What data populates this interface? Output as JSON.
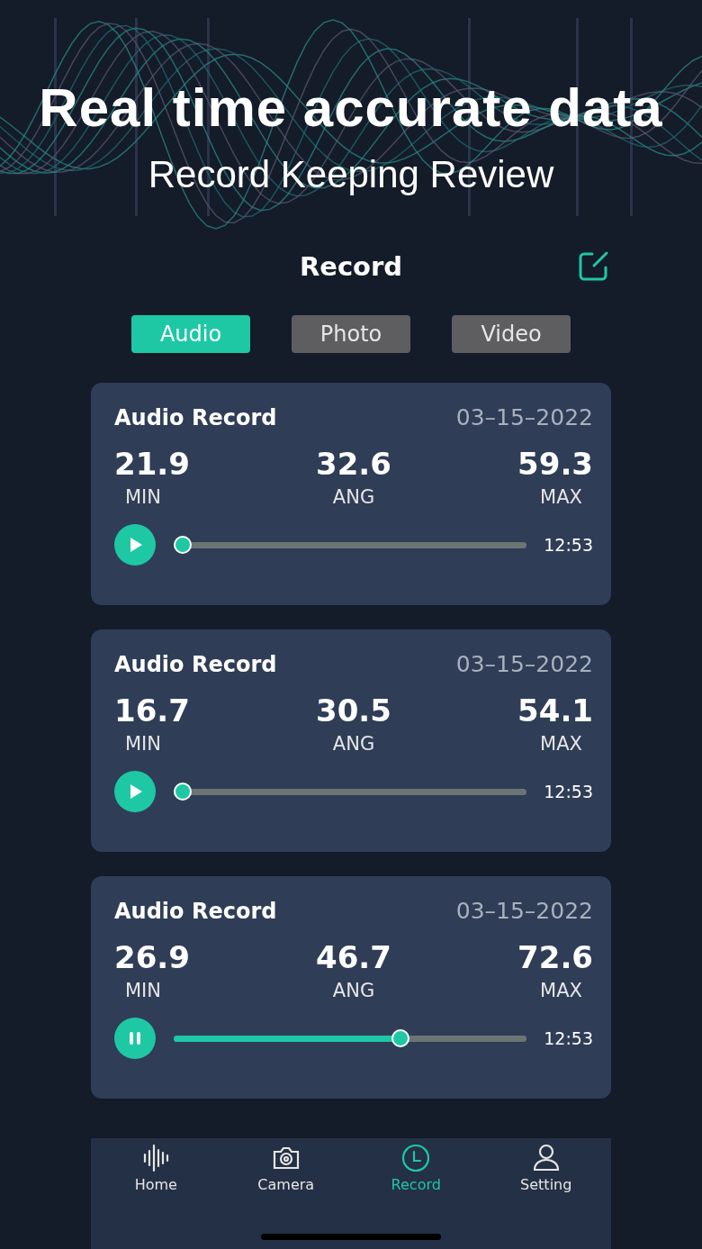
{
  "headline": "Real time accurate data",
  "subtitle": "Record Keeping Review",
  "screen": {
    "title": "Record",
    "tabs": [
      {
        "label": "Audio",
        "selected": true
      },
      {
        "label": "Photo",
        "selected": false
      },
      {
        "label": "Video",
        "selected": false
      }
    ],
    "records": [
      {
        "title": "Audio Record",
        "date": "03–15–2022",
        "stats": [
          {
            "value": "21.9",
            "label": "MIN"
          },
          {
            "value": "32.6",
            "label": "ANG"
          },
          {
            "value": "59.3",
            "label": "MAX"
          }
        ],
        "playing": false,
        "level": 0,
        "duration": "12:53"
      },
      {
        "title": "Audio Record",
        "date": "03–15–2022",
        "stats": [
          {
            "value": "16.7",
            "label": "MIN"
          },
          {
            "value": "30.5",
            "label": "ANG"
          },
          {
            "value": "54.1",
            "label": "MAX"
          }
        ],
        "playing": false,
        "level": 0,
        "duration": "12:53"
      },
      {
        "title": "Audio Record",
        "date": "03–15–2022",
        "stats": [
          {
            "value": "26.9",
            "label": "MIN"
          },
          {
            "value": "46.7",
            "label": "ANG"
          },
          {
            "value": "72.6",
            "label": "MAX"
          }
        ],
        "playing": true,
        "level": 0.65,
        "duration": "12:53"
      }
    ],
    "nav": [
      {
        "kind": "home",
        "label": "Home",
        "selected": false
      },
      {
        "kind": "camera",
        "label": "Camera",
        "selected": false
      },
      {
        "kind": "record",
        "label": "Record",
        "selected": true
      },
      {
        "kind": "setting",
        "label": "Setting",
        "selected": false
      }
    ]
  }
}
